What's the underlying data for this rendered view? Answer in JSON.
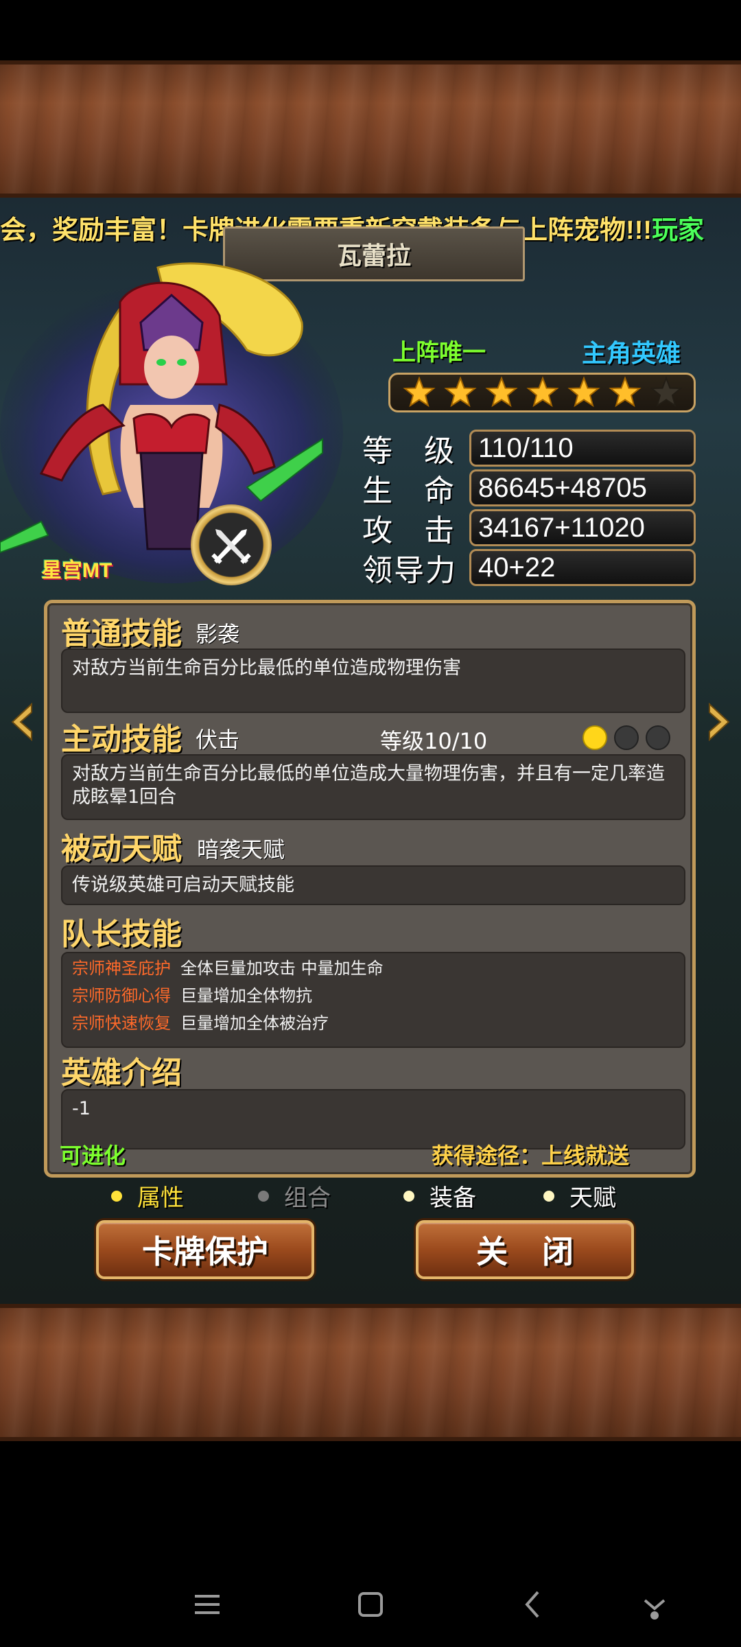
{
  "ticker": {
    "text_yellow": "会，奖励丰富！卡牌进化需要重新穿戴装备与上阵宠物!!!",
    "text_green": "玩家"
  },
  "hero": {
    "name": "瓦蕾拉",
    "portrait_label": "星宫MT",
    "tag_unique": "上阵唯一",
    "tag_role": "主角英雄",
    "stars_filled": 6,
    "stars_total": 7,
    "class_icon": "crossed-swords-icon"
  },
  "stats": [
    {
      "label": "等级",
      "value": "110/110"
    },
    {
      "label": "生命",
      "value": "86645+48705"
    },
    {
      "label": "攻击",
      "value": "34167+11020"
    },
    {
      "label": "领导力",
      "value": "40+22"
    }
  ],
  "skills": {
    "normal": {
      "title": "普通技能",
      "name": "影袭",
      "desc": "对敌方当前生命百分比最低的单位造成物理伤害"
    },
    "active": {
      "title": "主动技能",
      "name": "伏击",
      "level": "等级10/10",
      "desc": "对敌方当前生命百分比最低的单位造成大量物理伤害，并且有一定几率造成眩晕1回合",
      "dots_on": 1,
      "dots_total": 3
    },
    "passive": {
      "title": "被动天赋",
      "name": "暗袭天赋",
      "desc": "传说级英雄可启动天赋技能"
    },
    "captain": {
      "title": "队长技能",
      "items": [
        {
          "name": "宗师神圣庇护",
          "effect": "全体巨量加攻击 中量加生命"
        },
        {
          "name": "宗师防御心得",
          "effect": "巨量增加全体物抗"
        },
        {
          "name": "宗师快速恢复",
          "effect": "巨量增加全体被治疗"
        }
      ]
    },
    "intro": {
      "title": "英雄介绍",
      "desc": "-1"
    }
  },
  "footer": {
    "evolve": "可进化",
    "source": "获得途径：上线就送"
  },
  "tabs": [
    {
      "label": "属性",
      "state": "active"
    },
    {
      "label": "组合",
      "state": "disabled"
    },
    {
      "label": "装备",
      "state": "normal"
    },
    {
      "label": "天赋",
      "state": "normal"
    }
  ],
  "buttons": {
    "protect": "卡牌保护",
    "close": "关闭"
  },
  "colors": {
    "title_gold": "#ffd66a",
    "unique_green": "#7dff2e",
    "role_blue": "#32c8ff",
    "captain_orange": "#ff6a2a",
    "panel_bg": "#5b5651"
  }
}
